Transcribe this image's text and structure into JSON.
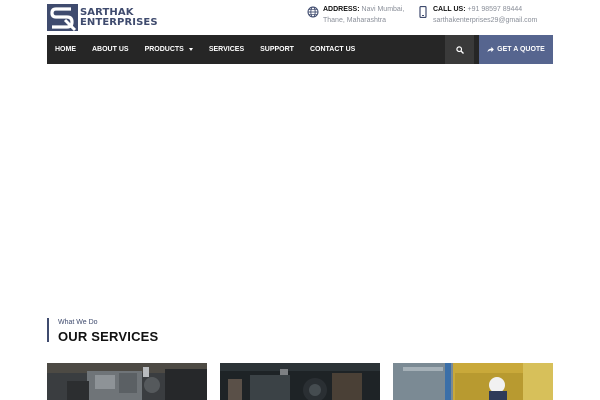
{
  "brand": {
    "line1": "SARTHAK",
    "line2": "ENTERPRISES",
    "color": "#3f4b6e"
  },
  "contact": {
    "address_label": "ADDRESS:",
    "address_line1": "Navi Mumbai,",
    "address_line2": "Thane, Maharashtra",
    "address_icon": "globe-icon",
    "call_label": "CALL US:",
    "call_phone": "+91 98597 89444",
    "call_email": "sarthakenterprises29@gmail.com",
    "call_icon": "mobile-phone-icon"
  },
  "nav": {
    "items": [
      {
        "label": "HOME"
      },
      {
        "label": "ABOUT US"
      },
      {
        "label": "PRODUCTS",
        "has_dropdown": true
      },
      {
        "label": "SERVICES"
      },
      {
        "label": "SUPPORT"
      },
      {
        "label": "CONTACT US"
      }
    ],
    "search_icon": "search-icon",
    "quote_label": "GET A QUOTE",
    "quote_icon": "share-arrow-icon",
    "bar_color": "#262626",
    "accent_color": "#56658f"
  },
  "services": {
    "eyebrow": "What We Do",
    "title": "OUR SERVICES",
    "cards": [
      {
        "image": "machinery-engine-photo"
      },
      {
        "image": "workshop-equipment-photo"
      },
      {
        "image": "industrial-technician-photo"
      }
    ]
  }
}
